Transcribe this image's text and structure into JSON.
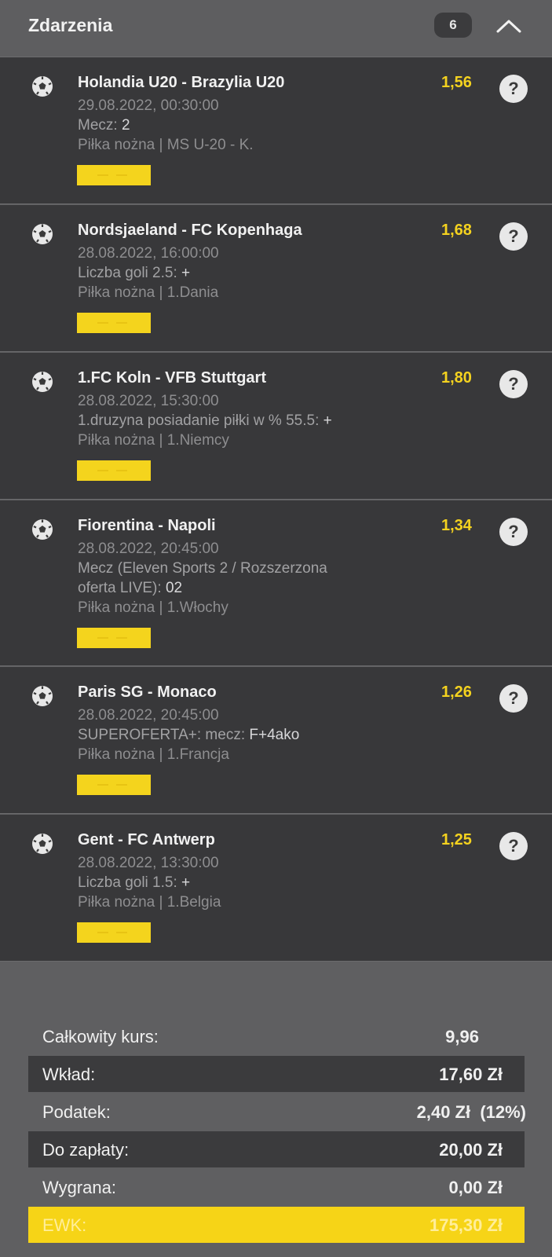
{
  "header": {
    "title": "Zdarzenia",
    "count": "6"
  },
  "events": [
    {
      "match": "Holandia U20 - Brazylia U20",
      "odds": "1,56",
      "datetime": "29.08.2022, 00:30:00",
      "market_label": "Mecz: ",
      "market_value": "2",
      "market_line2": "",
      "league": "Piłka nożna | MS U-20 - K."
    },
    {
      "match": "Nordsjaeland - FC Kopenhaga",
      "odds": "1,68",
      "datetime": "28.08.2022, 16:00:00",
      "market_label": "Liczba goli 2.5: ",
      "market_value": "+",
      "market_line2": "",
      "league": "Piłka nożna | 1.Dania"
    },
    {
      "match": "1.FC Koln - VFB Stuttgart",
      "odds": "1,80",
      "datetime": "28.08.2022, 15:30:00",
      "market_label": "1.druzyna posiadanie piłki w % 55.5: ",
      "market_value": "+",
      "market_line2": "",
      "league": "Piłka nożna | 1.Niemcy"
    },
    {
      "match": "Fiorentina - Napoli",
      "odds": "1,34",
      "datetime": "28.08.2022, 20:45:00",
      "market_label": "Mecz (Eleven Sports 2 / Rozszerzona",
      "market_value": "",
      "market_line2": "oferta LIVE): ",
      "market_value2": "02",
      "league": "Piłka nożna | 1.Włochy"
    },
    {
      "match": "Paris SG - Monaco",
      "odds": "1,26",
      "datetime": "28.08.2022, 20:45:00",
      "market_label": "SUPEROFERTA+: mecz: ",
      "market_value": "F+4ako",
      "market_line2": "",
      "league": "Piłka nożna | 1.Francja"
    },
    {
      "match": "Gent - FC Antwerp",
      "odds": "1,25",
      "datetime": "28.08.2022, 13:30:00",
      "market_label": "Liczba goli 1.5: ",
      "market_value": "+",
      "market_line2": "",
      "league": "Piłka nożna | 1.Belgia"
    }
  ],
  "summary": {
    "total_odds_label": "Całkowity kurs:",
    "total_odds": "9,96",
    "stake_label": "Wkład:",
    "stake": "17,60 Zł",
    "tax_label": "Podatek:",
    "tax": "2,40 Zł  (12%)",
    "to_pay_label": "Do zapłaty:",
    "to_pay": "20,00 Zł",
    "win_label": "Wygrana:",
    "win": "0,00 Zł",
    "ewk_label": "EWK:",
    "ewk": "175,30 Zł"
  },
  "colors": {
    "accent": "#f4d21f",
    "panel": "#38383a",
    "background": "#5f5f61"
  }
}
